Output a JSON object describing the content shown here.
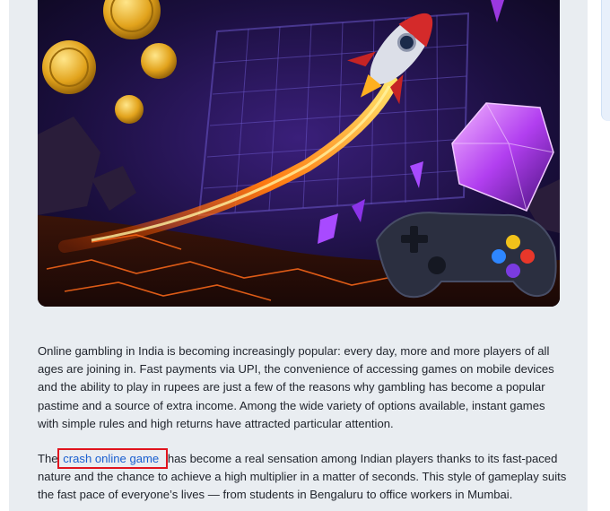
{
  "article": {
    "paragraph1": "Online gambling in India is becoming increasingly popular: every day, more and more players of all ages are joining in. Fast payments via UPI, the convenience of accessing games on mobile devices and the ability to play in rupees are just a few of the reasons why gambling has become a popular pastime and a source of extra income. Among the wide variety of options available, instant games with simple rules and high returns have attracted particular attention.",
    "paragraph2_before": "The",
    "paragraph2_link": "crash online game",
    "paragraph2_after": "has become a real sensation among Indian players thanks to its fast-paced nature and the chance to achieve a high multiplier in a matter of seconds. This style of gameplay suits the fast pace of everyone’s lives — from students in Bengaluru to office workers in Mumbai."
  },
  "hero_image": {
    "icons": [
      "rocket-icon",
      "gold-coin-icon",
      "purple-crystal-icon",
      "gamepad-icon"
    ]
  },
  "colors": {
    "article_bg": "#e9edf1",
    "link": "#1a5fd0",
    "highlight_box": "#e0141e",
    "text": "#1f232b"
  }
}
